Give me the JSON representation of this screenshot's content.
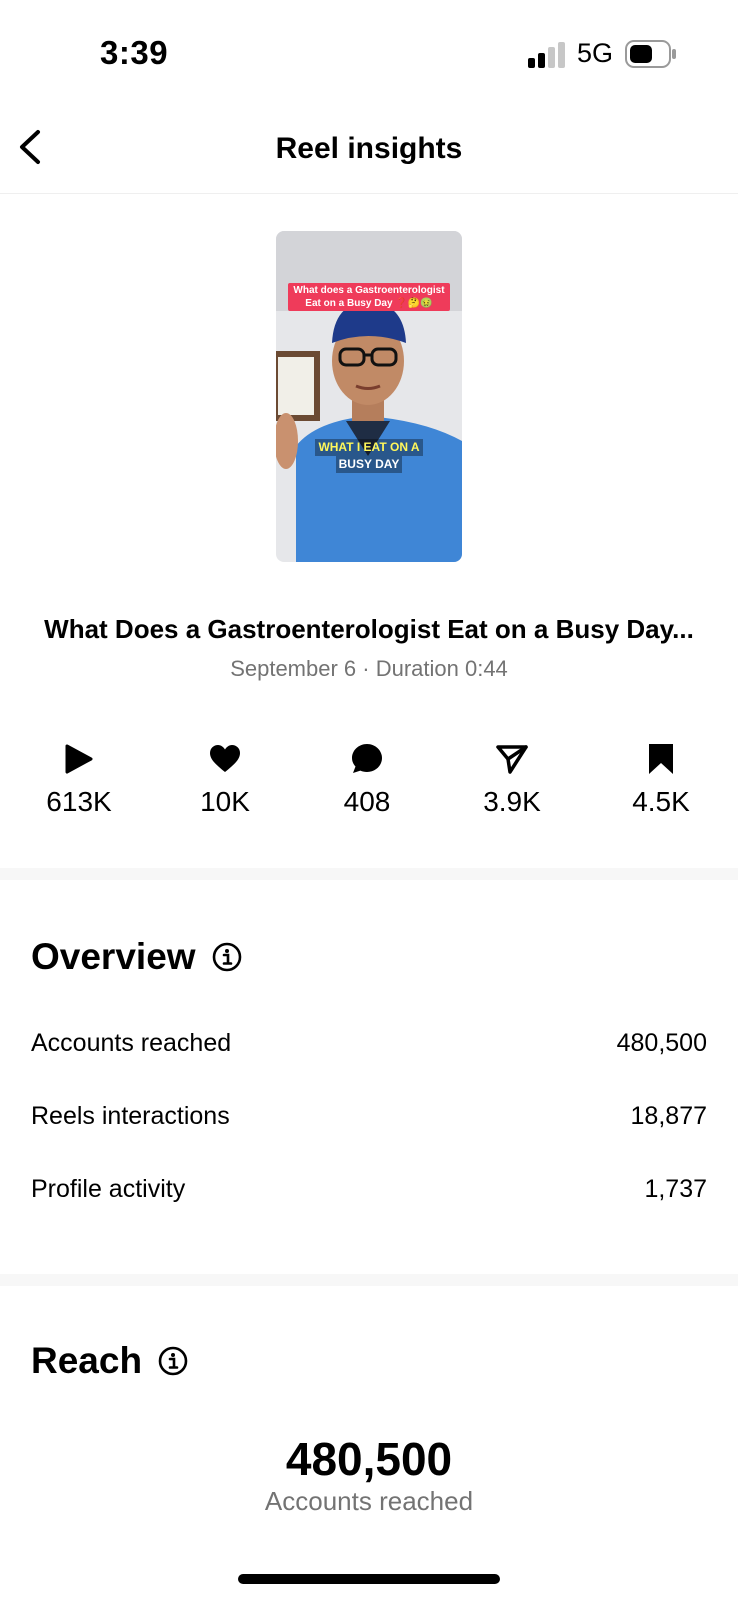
{
  "status_bar": {
    "time": "3:39",
    "network": "5G"
  },
  "nav": {
    "title": "Reel insights"
  },
  "reel": {
    "thumbnail_caption_top": "What does a Gastroenterologist Eat on a Busy Day ❓🤔🤢",
    "thumbnail_caption_line1": "WHAT I EAT ON A",
    "thumbnail_caption_line2": "BUSY DAY",
    "title": "What Does a Gastroenterologist Eat on a Busy Day...",
    "meta": "September 6 · Duration 0:44"
  },
  "stats": {
    "plays": "613K",
    "likes": "10K",
    "comments": "408",
    "shares": "3.9K",
    "saves": "4.5K"
  },
  "overview": {
    "title": "Overview",
    "rows": [
      {
        "label": "Accounts reached",
        "value": "480,500"
      },
      {
        "label": "Reels interactions",
        "value": "18,877"
      },
      {
        "label": "Profile activity",
        "value": "1,737"
      }
    ]
  },
  "reach": {
    "title": "Reach",
    "value": "480,500",
    "label": "Accounts reached"
  },
  "icons": {
    "back": "chevron-left-icon",
    "plays": "play-icon",
    "likes": "heart-icon",
    "comments": "comment-bubble-icon",
    "shares": "paper-plane-icon",
    "saves": "bookmark-icon",
    "info": "info-circle-icon"
  }
}
